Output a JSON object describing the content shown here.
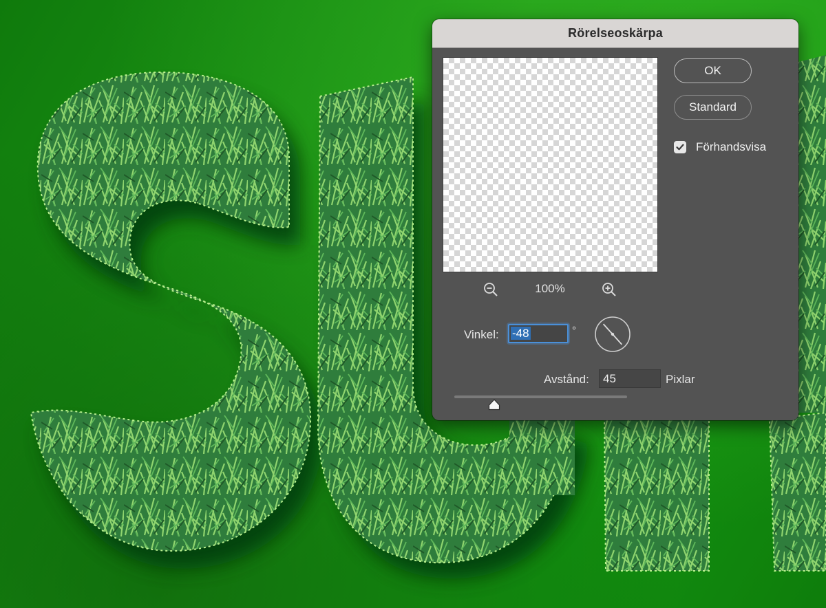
{
  "dialog": {
    "title": "Rörelseoskärpa",
    "ok_label": "OK",
    "default_label": "Standard",
    "preview_checkbox": {
      "label": "Förhandsvisa",
      "checked": true
    },
    "zoom": {
      "value": "100%"
    },
    "angle": {
      "label": "Vinkel:",
      "value": "-48",
      "unit": "°"
    },
    "distance": {
      "label": "Avstånd:",
      "value": "45",
      "unit": "Pixlar",
      "slider_fraction": 0.23
    }
  },
  "icons": {
    "zoom_out": "magnifier-minus-icon",
    "zoom_in": "magnifier-plus-icon",
    "checkbox": "checkmark-icon",
    "angle_dial": "angle-dial-icon",
    "slider_thumb": "slider-thumb-icon"
  },
  "colors": {
    "canvas_green": "#1d8a12",
    "grass_light": "#9be07a",
    "grass_dark": "#1f5a28",
    "dialog_bg": "#535353",
    "title_bar": "#d9d6d4",
    "focus_blue": "#4a90d9"
  }
}
